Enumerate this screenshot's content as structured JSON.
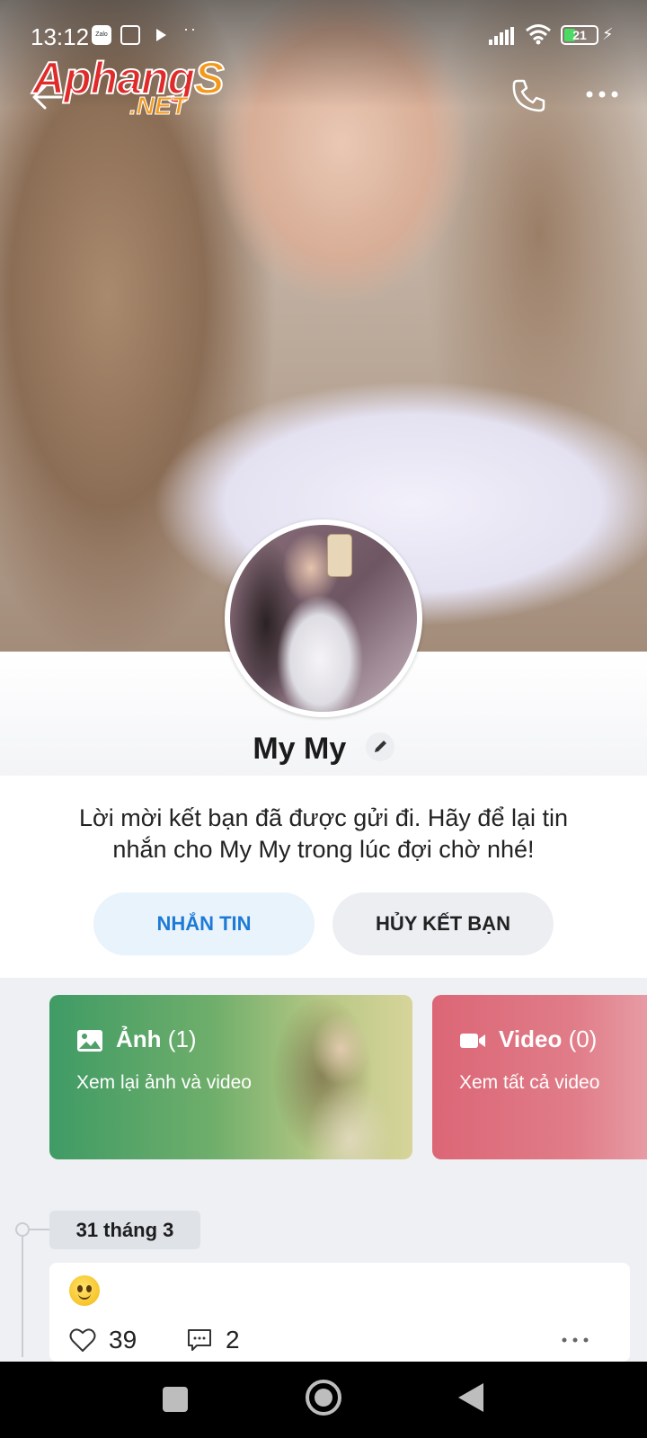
{
  "status_bar": {
    "time": "13:12",
    "zalo_badge": "Zalo",
    "battery_level": "21"
  },
  "watermark": {
    "part1": "Aphang",
    "part2": "S",
    "domain": ".NET"
  },
  "profile": {
    "name": "My My"
  },
  "friend_request": {
    "message": "Lời mời kết bạn đã được gửi đi. Hãy để lại tin nhắn cho My My trong lúc đợi chờ nhé!",
    "message_button": "NHẮN TIN",
    "unfriend_button": "HỦY KẾT BẠN"
  },
  "media": {
    "photos": {
      "title": "Ảnh",
      "count": "(1)",
      "subtitle": "Xem lại ảnh và video"
    },
    "videos": {
      "title": "Video",
      "count": "(0)",
      "subtitle": "Xem tất cả video"
    }
  },
  "timeline": {
    "date": "31 tháng 3",
    "post": {
      "likes": "39",
      "comments": "2"
    }
  },
  "colors": {
    "accent": "#1d7ad6",
    "photos_tile": "#3f9b65",
    "video_tile": "#dc6676"
  },
  "icons": [
    "back-arrow-icon",
    "phone-icon",
    "more-horizontal-icon",
    "edit-pencil-icon",
    "image-icon",
    "video-camera-icon",
    "heart-icon",
    "comment-icon",
    "smiley-emoji-icon"
  ]
}
